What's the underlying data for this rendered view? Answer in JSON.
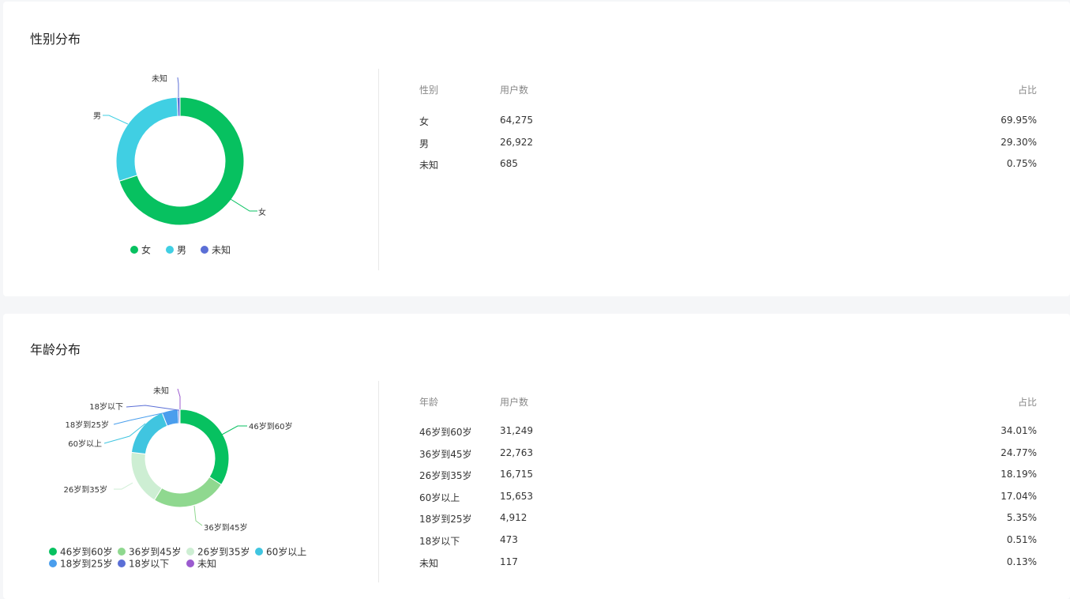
{
  "gender": {
    "title": "性别分布",
    "table_headers": [
      "性别",
      "用户数",
      "占比"
    ],
    "rows": [
      {
        "label": "女",
        "count": "64,275",
        "pct": "69.95%"
      },
      {
        "label": "男",
        "count": "26,922",
        "pct": "29.30%"
      },
      {
        "label": "未知",
        "count": "685",
        "pct": "0.75%"
      }
    ]
  },
  "age": {
    "title": "年龄分布",
    "table_headers": [
      "年龄",
      "用户数",
      "占比"
    ],
    "rows": [
      {
        "label": "46岁到60岁",
        "count": "31,249",
        "pct": "34.01%"
      },
      {
        "label": "36岁到45岁",
        "count": "22,763",
        "pct": "24.77%"
      },
      {
        "label": "26岁到35岁",
        "count": "16,715",
        "pct": "18.19%"
      },
      {
        "label": "60岁以上",
        "count": "15,653",
        "pct": "17.04%"
      },
      {
        "label": "18岁到25岁",
        "count": "4,912",
        "pct": "5.35%"
      },
      {
        "label": "18岁以下",
        "count": "473",
        "pct": "0.51%"
      },
      {
        "label": "未知",
        "count": "117",
        "pct": "0.13%"
      }
    ]
  },
  "chart_data": [
    {
      "type": "pie",
      "variant": "donut",
      "title": "性别分布",
      "categories": [
        "女",
        "男",
        "未知"
      ],
      "values": [
        64275,
        26922,
        685
      ],
      "colors": [
        "#07c160",
        "#40cfe3",
        "#5b6fd6"
      ],
      "legend": "bottom"
    },
    {
      "type": "pie",
      "variant": "donut",
      "title": "年龄分布",
      "categories": [
        "46岁到60岁",
        "36岁到45岁",
        "26岁到35岁",
        "60岁以上",
        "18岁到25岁",
        "18岁以下",
        "未知"
      ],
      "values": [
        31249,
        22763,
        16715,
        15653,
        4912,
        473,
        117
      ],
      "colors": [
        "#07c160",
        "#8fd88f",
        "#cdeed3",
        "#40c5e0",
        "#4a9eed",
        "#5b6fd6",
        "#9b5bcf"
      ],
      "legend": "bottom"
    }
  ]
}
